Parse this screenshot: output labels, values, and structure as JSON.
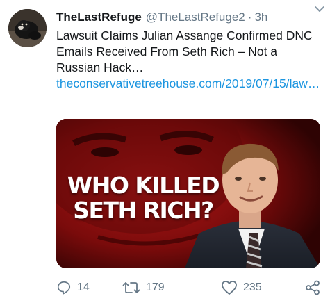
{
  "tweet": {
    "author_name": "TheLastRefuge",
    "handle": "@TheLastRefuge2",
    "separator": "·",
    "time": "3h",
    "text": "Lawsuit Claims Julian Assange Confirmed DNC Emails Received From Seth Rich – Not a Russian Hack…",
    "link": "theconservativetreehouse.com/2019/07/15/law…"
  },
  "media": {
    "headline_line1": "WHO KILLED",
    "headline_line2": "SETH RICH?"
  },
  "actions": {
    "reply_count": "14",
    "retweet_count": "179",
    "like_count": "235"
  },
  "icons": {
    "reply": "reply-icon",
    "retweet": "retweet-icon",
    "like": "heart-icon",
    "share": "share-icon",
    "menu": "chevron-down-icon"
  },
  "colors": {
    "link": "#1b95e0",
    "secondary_text": "#657786",
    "media_background": "#8a0e0e"
  }
}
